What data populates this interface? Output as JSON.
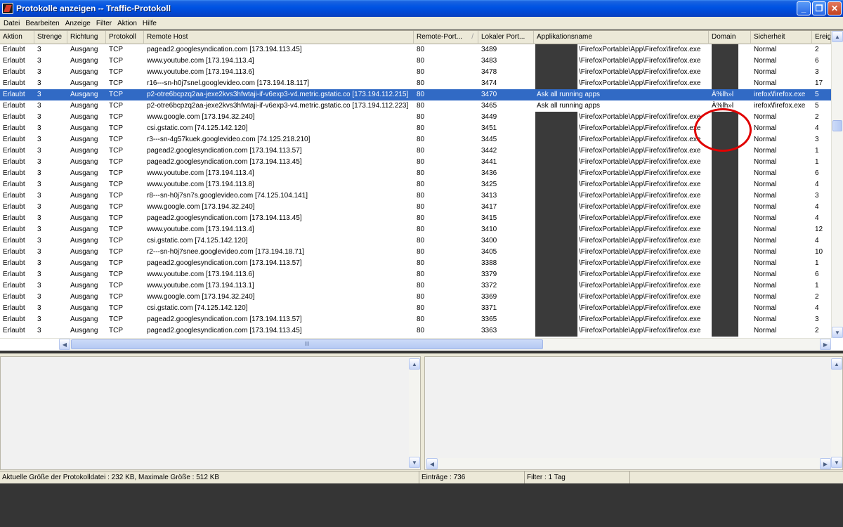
{
  "window": {
    "title": "Protokolle anzeigen -- Traffic-Protokoll",
    "minimize_glyph": "_",
    "restore_glyph": "❐",
    "close_glyph": "✕"
  },
  "menu": [
    "Datei",
    "Bearbeiten",
    "Anzeige",
    "Filter",
    "Aktion",
    "Hilfe"
  ],
  "columns": [
    "Aktion",
    "Strenge",
    "Richtung",
    "Protokoll",
    "Remote Host",
    "Remote-Port...",
    "Lokaler Port...",
    "Applikationsname",
    "Domain",
    "Sicherheit",
    "Ereig"
  ],
  "sort_indicator": "/",
  "rows": [
    {
      "aktion": "Erlaubt",
      "strenge": "3",
      "richtung": "Ausgang",
      "protokoll": "TCP",
      "host": "pagead2.googlesyndication.com [173.194.113.45]",
      "rport": "80",
      "lport": "3489",
      "app": "\\FirefoxPortable\\App\\Firefox\\firefox.exe",
      "domain": "",
      "sicherheit": "Normal",
      "ereig": "2"
    },
    {
      "aktion": "Erlaubt",
      "strenge": "3",
      "richtung": "Ausgang",
      "protokoll": "TCP",
      "host": "www.youtube.com [173.194.113.4]",
      "rport": "80",
      "lport": "3483",
      "app": "\\FirefoxPortable\\App\\Firefox\\firefox.exe",
      "domain": "",
      "sicherheit": "Normal",
      "ereig": "6"
    },
    {
      "aktion": "Erlaubt",
      "strenge": "3",
      "richtung": "Ausgang",
      "protokoll": "TCP",
      "host": "www.youtube.com [173.194.113.6]",
      "rport": "80",
      "lport": "3478",
      "app": "\\FirefoxPortable\\App\\Firefox\\firefox.exe",
      "domain": "",
      "sicherheit": "Normal",
      "ereig": "3"
    },
    {
      "aktion": "Erlaubt",
      "strenge": "3",
      "richtung": "Ausgang",
      "protokoll": "TCP",
      "host": "r16---sn-h0j7snel.googlevideo.com [173.194.18.117]",
      "rport": "80",
      "lport": "3474",
      "app": "\\FirefoxPortable\\App\\Firefox\\firefox.exe",
      "domain": "",
      "sicherheit": "Normal",
      "ereig": "17"
    },
    {
      "aktion": "Erlaubt",
      "strenge": "3",
      "richtung": "Ausgang",
      "protokoll": "TCP",
      "host": "p2-otre6bcpzq2aa-jexe2kvs3hfwtaji-if-v6exp3-v4.metric.gstatic.co [173.194.112.215]",
      "rport": "80",
      "lport": "3470",
      "app": "Ask all running apps",
      "domain": "À%lh»l",
      "sicherheit": "irefox\\firefox.exe",
      "ereig": "5",
      "selected": true,
      "ask": true
    },
    {
      "aktion": "Erlaubt",
      "strenge": "3",
      "richtung": "Ausgang",
      "protokoll": "TCP",
      "host": "p2-otre6bcpzq2aa-jexe2kvs3hfwtaji-if-v6exp3-v4.metric.gstatic.co [173.194.112.223]",
      "rport": "80",
      "lport": "3465",
      "app": "Ask all running apps",
      "domain": "À%lh»l",
      "sicherheit": "irefox\\firefox.exe",
      "ereig": "5",
      "ask": true
    },
    {
      "aktion": "Erlaubt",
      "strenge": "3",
      "richtung": "Ausgang",
      "protokoll": "TCP",
      "host": "www.google.com [173.194.32.240]",
      "rport": "80",
      "lport": "3449",
      "app": "\\FirefoxPortable\\App\\Firefox\\firefox.exe",
      "domain": "",
      "sicherheit": "Normal",
      "ereig": "2"
    },
    {
      "aktion": "Erlaubt",
      "strenge": "3",
      "richtung": "Ausgang",
      "protokoll": "TCP",
      "host": "csi.gstatic.com [74.125.142.120]",
      "rport": "80",
      "lport": "3451",
      "app": "\\FirefoxPortable\\App\\Firefox\\firefox.exe",
      "domain": "",
      "sicherheit": "Normal",
      "ereig": "4"
    },
    {
      "aktion": "Erlaubt",
      "strenge": "3",
      "richtung": "Ausgang",
      "protokoll": "TCP",
      "host": "r3---sn-4g57kuek.googlevideo.com [74.125.218.210]",
      "rport": "80",
      "lport": "3445",
      "app": "\\FirefoxPortable\\App\\Firefox\\firefox.exe",
      "domain": "",
      "sicherheit": "Normal",
      "ereig": "3"
    },
    {
      "aktion": "Erlaubt",
      "strenge": "3",
      "richtung": "Ausgang",
      "protokoll": "TCP",
      "host": "pagead2.googlesyndication.com [173.194.113.57]",
      "rport": "80",
      "lport": "3442",
      "app": "\\FirefoxPortable\\App\\Firefox\\firefox.exe",
      "domain": "",
      "sicherheit": "Normal",
      "ereig": "1"
    },
    {
      "aktion": "Erlaubt",
      "strenge": "3",
      "richtung": "Ausgang",
      "protokoll": "TCP",
      "host": "pagead2.googlesyndication.com [173.194.113.45]",
      "rport": "80",
      "lport": "3441",
      "app": "\\FirefoxPortable\\App\\Firefox\\firefox.exe",
      "domain": "",
      "sicherheit": "Normal",
      "ereig": "1"
    },
    {
      "aktion": "Erlaubt",
      "strenge": "3",
      "richtung": "Ausgang",
      "protokoll": "TCP",
      "host": "www.youtube.com [173.194.113.4]",
      "rport": "80",
      "lport": "3436",
      "app": "\\FirefoxPortable\\App\\Firefox\\firefox.exe",
      "domain": "",
      "sicherheit": "Normal",
      "ereig": "6"
    },
    {
      "aktion": "Erlaubt",
      "strenge": "3",
      "richtung": "Ausgang",
      "protokoll": "TCP",
      "host": "www.youtube.com [173.194.113.8]",
      "rport": "80",
      "lport": "3425",
      "app": "\\FirefoxPortable\\App\\Firefox\\firefox.exe",
      "domain": "",
      "sicherheit": "Normal",
      "ereig": "4"
    },
    {
      "aktion": "Erlaubt",
      "strenge": "3",
      "richtung": "Ausgang",
      "protokoll": "TCP",
      "host": "r8---sn-h0j7sn7s.googlevideo.com [74.125.104.141]",
      "rport": "80",
      "lport": "3413",
      "app": "\\FirefoxPortable\\App\\Firefox\\firefox.exe",
      "domain": "",
      "sicherheit": "Normal",
      "ereig": "3"
    },
    {
      "aktion": "Erlaubt",
      "strenge": "3",
      "richtung": "Ausgang",
      "protokoll": "TCP",
      "host": "www.google.com [173.194.32.240]",
      "rport": "80",
      "lport": "3417",
      "app": "\\FirefoxPortable\\App\\Firefox\\firefox.exe",
      "domain": "",
      "sicherheit": "Normal",
      "ereig": "4"
    },
    {
      "aktion": "Erlaubt",
      "strenge": "3",
      "richtung": "Ausgang",
      "protokoll": "TCP",
      "host": "pagead2.googlesyndication.com [173.194.113.45]",
      "rport": "80",
      "lport": "3415",
      "app": "\\FirefoxPortable\\App\\Firefox\\firefox.exe",
      "domain": "",
      "sicherheit": "Normal",
      "ereig": "4"
    },
    {
      "aktion": "Erlaubt",
      "strenge": "3",
      "richtung": "Ausgang",
      "protokoll": "TCP",
      "host": "www.youtube.com [173.194.113.4]",
      "rport": "80",
      "lport": "3410",
      "app": "\\FirefoxPortable\\App\\Firefox\\firefox.exe",
      "domain": "",
      "sicherheit": "Normal",
      "ereig": "12"
    },
    {
      "aktion": "Erlaubt",
      "strenge": "3",
      "richtung": "Ausgang",
      "protokoll": "TCP",
      "host": "csi.gstatic.com [74.125.142.120]",
      "rport": "80",
      "lport": "3400",
      "app": "\\FirefoxPortable\\App\\Firefox\\firefox.exe",
      "domain": "",
      "sicherheit": "Normal",
      "ereig": "4"
    },
    {
      "aktion": "Erlaubt",
      "strenge": "3",
      "richtung": "Ausgang",
      "protokoll": "TCP",
      "host": "r2---sn-h0j7snee.googlevideo.com [173.194.18.71]",
      "rport": "80",
      "lport": "3405",
      "app": "\\FirefoxPortable\\App\\Firefox\\firefox.exe",
      "domain": "",
      "sicherheit": "Normal",
      "ereig": "10"
    },
    {
      "aktion": "Erlaubt",
      "strenge": "3",
      "richtung": "Ausgang",
      "protokoll": "TCP",
      "host": "pagead2.googlesyndication.com [173.194.113.57]",
      "rport": "80",
      "lport": "3388",
      "app": "\\FirefoxPortable\\App\\Firefox\\firefox.exe",
      "domain": "",
      "sicherheit": "Normal",
      "ereig": "1"
    },
    {
      "aktion": "Erlaubt",
      "strenge": "3",
      "richtung": "Ausgang",
      "protokoll": "TCP",
      "host": "www.youtube.com [173.194.113.6]",
      "rport": "80",
      "lport": "3379",
      "app": "\\FirefoxPortable\\App\\Firefox\\firefox.exe",
      "domain": "",
      "sicherheit": "Normal",
      "ereig": "6"
    },
    {
      "aktion": "Erlaubt",
      "strenge": "3",
      "richtung": "Ausgang",
      "protokoll": "TCP",
      "host": "www.youtube.com [173.194.113.1]",
      "rport": "80",
      "lport": "3372",
      "app": "\\FirefoxPortable\\App\\Firefox\\firefox.exe",
      "domain": "",
      "sicherheit": "Normal",
      "ereig": "1"
    },
    {
      "aktion": "Erlaubt",
      "strenge": "3",
      "richtung": "Ausgang",
      "protokoll": "TCP",
      "host": "www.google.com [173.194.32.240]",
      "rport": "80",
      "lport": "3369",
      "app": "\\FirefoxPortable\\App\\Firefox\\firefox.exe",
      "domain": "",
      "sicherheit": "Normal",
      "ereig": "2"
    },
    {
      "aktion": "Erlaubt",
      "strenge": "3",
      "richtung": "Ausgang",
      "protokoll": "TCP",
      "host": "csi.gstatic.com [74.125.142.120]",
      "rport": "80",
      "lport": "3371",
      "app": "\\FirefoxPortable\\App\\Firefox\\firefox.exe",
      "domain": "",
      "sicherheit": "Normal",
      "ereig": "4"
    },
    {
      "aktion": "Erlaubt",
      "strenge": "3",
      "richtung": "Ausgang",
      "protokoll": "TCP",
      "host": "pagead2.googlesyndication.com [173.194.113.57]",
      "rport": "80",
      "lport": "3365",
      "app": "\\FirefoxPortable\\App\\Firefox\\firefox.exe",
      "domain": "",
      "sicherheit": "Normal",
      "ereig": "3"
    },
    {
      "aktion": "Erlaubt",
      "strenge": "3",
      "richtung": "Ausgang",
      "protokoll": "TCP",
      "host": "pagead2.googlesyndication.com [173.194.113.45]",
      "rport": "80",
      "lport": "3363",
      "app": "\\FirefoxPortable\\App\\Firefox\\firefox.exe",
      "domain": "",
      "sicherheit": "Normal",
      "ereig": "2"
    }
  ],
  "hscroll_grip": "III",
  "status": {
    "size": "Aktuelle Größe der Protokolldatei :  232 KB, Maximale Größe : 512 KB",
    "entries": "Einträge : 736",
    "filter": "Filter : 1 Tag"
  },
  "colors": {
    "selection": "#316ac5",
    "annotation": "#e00000",
    "redaction": "#3a3a3a"
  }
}
